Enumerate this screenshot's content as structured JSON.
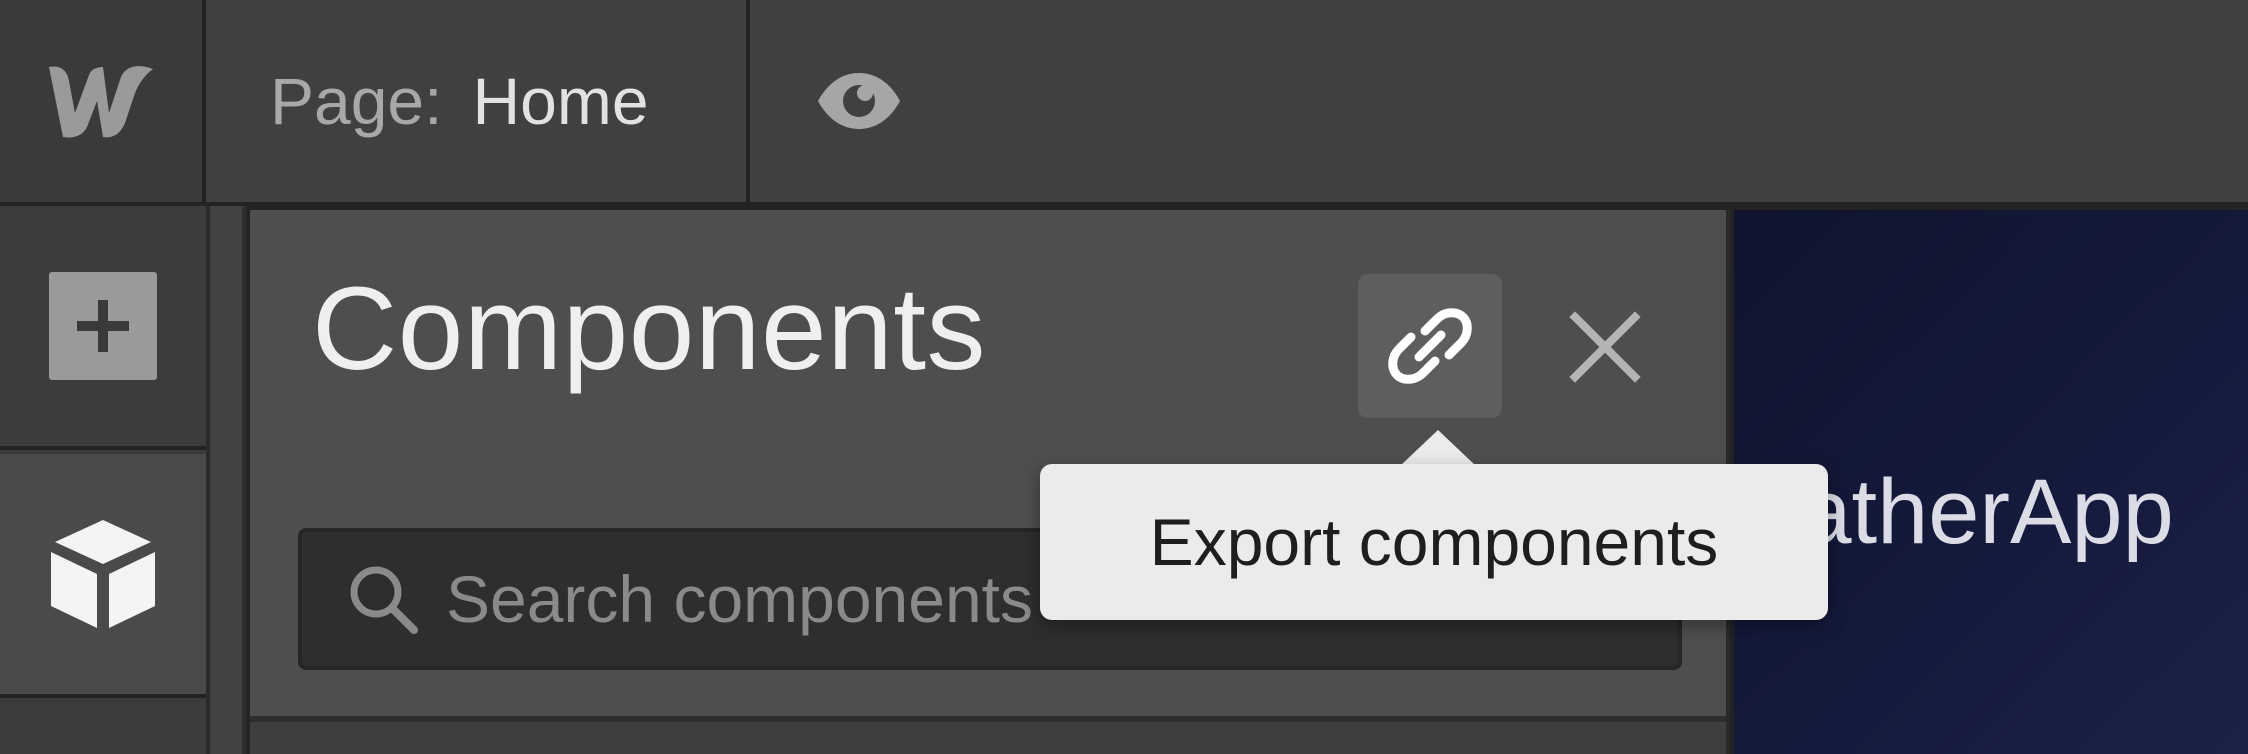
{
  "header": {
    "logo_icon": "webflow-logo-icon",
    "page_prefix": "Page:",
    "page_name": "Home",
    "preview_icon": "eye-icon"
  },
  "left_rail": {
    "items": [
      {
        "name": "add",
        "icon": "plus-icon"
      },
      {
        "name": "components",
        "icon": "cube-icon",
        "active": true
      }
    ]
  },
  "panel": {
    "title": "Components",
    "export_icon": "link-icon",
    "close_icon": "close-icon",
    "search": {
      "placeholder": "Search components",
      "value": "",
      "icon": "search-icon"
    }
  },
  "tooltip": {
    "text": "Export components"
  },
  "canvas": {
    "app_name": "WeatherApp"
  },
  "colors": {
    "topbar": "#404040",
    "panel": "#4e4e4e",
    "canvas_bg": "#141a3c",
    "tooltip_bg": "#ebebeb"
  }
}
